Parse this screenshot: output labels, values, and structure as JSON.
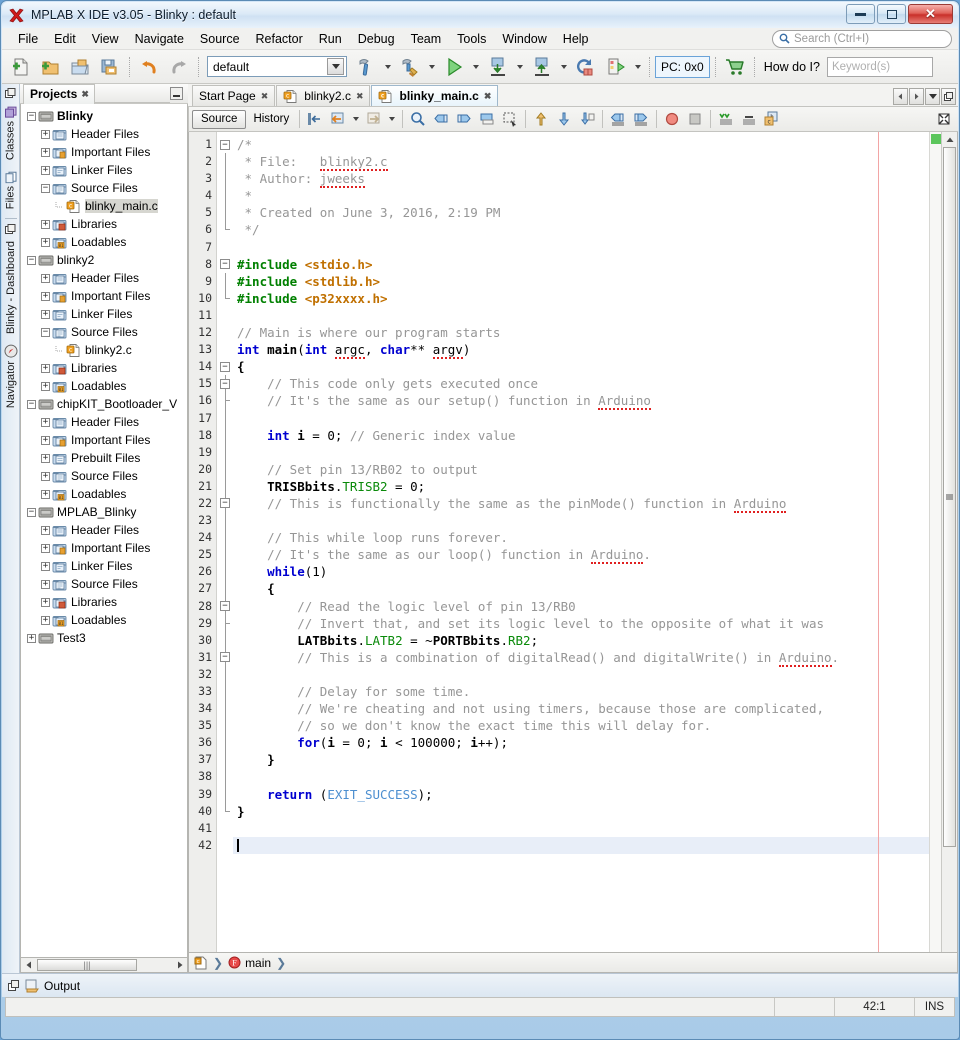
{
  "window": {
    "title": "MPLAB X IDE v3.05 - Blinky : default",
    "app_icon": "mplab-x-icon",
    "minimize": "minimize",
    "maximize": "maximize",
    "close": "close"
  },
  "menubar": {
    "items": [
      "File",
      "Edit",
      "View",
      "Navigate",
      "Source",
      "Refactor",
      "Run",
      "Debug",
      "Team",
      "Tools",
      "Window",
      "Help"
    ],
    "search_placeholder": "Search (Ctrl+I)"
  },
  "toolbar": {
    "buttons": [
      {
        "name": "new-file",
        "icon": "new-file-icon"
      },
      {
        "name": "new-project",
        "icon": "new-project-icon"
      },
      {
        "name": "open-project",
        "icon": "open-project-icon"
      },
      {
        "name": "save-all",
        "icon": "save-all-icon"
      },
      {
        "name": "undo",
        "icon": "undo-icon"
      },
      {
        "name": "redo",
        "icon": "redo-icon"
      }
    ],
    "configuration": "default",
    "build_buttons": [
      {
        "name": "build-project",
        "icon": "hammer-icon"
      },
      {
        "name": "clean-and-build",
        "icon": "hammer-broom-icon"
      },
      {
        "name": "run-project",
        "icon": "run-green-arrow-icon"
      },
      {
        "name": "debug-project",
        "icon": "debug-down-icon"
      },
      {
        "name": "program-device",
        "icon": "program-up-icon"
      },
      {
        "name": "hold-in-reset",
        "icon": "reset-icon"
      },
      {
        "name": "step-over",
        "icon": "step-icon"
      }
    ],
    "pc_indicator": "PC: 0x0",
    "cart_icon": "shopping-cart-icon",
    "how_do_i_label": "How do I?",
    "keyword_placeholder": "Keyword(s)"
  },
  "leftstrip": {
    "items": [
      "Classes",
      "Files",
      "Blinky - Dashboard",
      "Navigator"
    ]
  },
  "projects": {
    "tab_label": "Projects",
    "tree": [
      {
        "indent": 0,
        "toggle": "minus",
        "icon": "project-icon",
        "label": "Blinky",
        "bold": true
      },
      {
        "indent": 1,
        "toggle": "plus",
        "icon": "folder-header",
        "label": "Header Files"
      },
      {
        "indent": 1,
        "toggle": "plus",
        "icon": "folder-important",
        "label": "Important Files"
      },
      {
        "indent": 1,
        "toggle": "plus",
        "icon": "folder-linker",
        "label": "Linker Files"
      },
      {
        "indent": 1,
        "toggle": "minus",
        "icon": "folder-source",
        "label": "Source Files"
      },
      {
        "indent": 2,
        "toggle": "none",
        "icon": "c-file-icon",
        "label": "blinky_main.c",
        "selected": true
      },
      {
        "indent": 1,
        "toggle": "plus",
        "icon": "folder-lib",
        "label": "Libraries"
      },
      {
        "indent": 1,
        "toggle": "plus",
        "icon": "folder-load",
        "label": "Loadables"
      },
      {
        "indent": 0,
        "toggle": "minus",
        "icon": "project-icon",
        "label": "blinky2"
      },
      {
        "indent": 1,
        "toggle": "plus",
        "icon": "folder-header",
        "label": "Header Files"
      },
      {
        "indent": 1,
        "toggle": "plus",
        "icon": "folder-important",
        "label": "Important Files"
      },
      {
        "indent": 1,
        "toggle": "plus",
        "icon": "folder-linker",
        "label": "Linker Files"
      },
      {
        "indent": 1,
        "toggle": "minus",
        "icon": "folder-source",
        "label": "Source Files"
      },
      {
        "indent": 2,
        "toggle": "none",
        "icon": "c-file-icon",
        "label": "blinky2.c"
      },
      {
        "indent": 1,
        "toggle": "plus",
        "icon": "folder-lib",
        "label": "Libraries"
      },
      {
        "indent": 1,
        "toggle": "plus",
        "icon": "folder-load",
        "label": "Loadables"
      },
      {
        "indent": 0,
        "toggle": "minus",
        "icon": "project-icon",
        "label": "chipKIT_Bootloader_V"
      },
      {
        "indent": 1,
        "toggle": "plus",
        "icon": "folder-header",
        "label": "Header Files"
      },
      {
        "indent": 1,
        "toggle": "plus",
        "icon": "folder-important",
        "label": "Important Files"
      },
      {
        "indent": 1,
        "toggle": "plus",
        "icon": "folder-prebuilt",
        "label": "Prebuilt Files"
      },
      {
        "indent": 1,
        "toggle": "plus",
        "icon": "folder-source",
        "label": "Source Files"
      },
      {
        "indent": 1,
        "toggle": "plus",
        "icon": "folder-load",
        "label": "Loadables"
      },
      {
        "indent": 0,
        "toggle": "minus",
        "icon": "project-icon",
        "label": "MPLAB_Blinky"
      },
      {
        "indent": 1,
        "toggle": "plus",
        "icon": "folder-header",
        "label": "Header Files"
      },
      {
        "indent": 1,
        "toggle": "plus",
        "icon": "folder-important",
        "label": "Important Files"
      },
      {
        "indent": 1,
        "toggle": "plus",
        "icon": "folder-linker",
        "label": "Linker Files"
      },
      {
        "indent": 1,
        "toggle": "plus",
        "icon": "folder-source",
        "label": "Source Files"
      },
      {
        "indent": 1,
        "toggle": "plus",
        "icon": "folder-lib",
        "label": "Libraries"
      },
      {
        "indent": 1,
        "toggle": "plus",
        "icon": "folder-load",
        "label": "Loadables"
      },
      {
        "indent": 0,
        "toggle": "plus",
        "icon": "project-icon",
        "label": "Test3"
      }
    ]
  },
  "editor": {
    "tabs": [
      {
        "label": "Start Page",
        "icon": null,
        "active": false
      },
      {
        "label": "blinky2.c",
        "icon": "c-file-icon",
        "active": false
      },
      {
        "label": "blinky_main.c",
        "icon": "c-file-icon",
        "active": true
      }
    ],
    "view_buttons": {
      "source": "Source",
      "history": "History"
    },
    "toolbar_icons": [
      "last-edit-icon",
      "back-icon",
      "forward-icon",
      "find-selection-icon",
      "previous-bookmark-icon",
      "next-bookmark-icon",
      "toggle-bookmark-icon",
      "rectangular-selection-icon",
      "previous-error-icon",
      "next-error-icon",
      "inspect-icon",
      "shift-left-icon",
      "shift-right-icon",
      "toggle-breakpoint-icon",
      "stop-icon",
      "comment-icon",
      "uncomment-icon",
      "header-source-icon"
    ],
    "maximize_icon": "maximize-window-icon",
    "breadcrumb": {
      "file_icon": "c-file-icon",
      "member_icon": "function-icon",
      "member": "main"
    },
    "status": {
      "position": "42:1",
      "mode": "INS"
    },
    "cursor_line": 42,
    "total_lines": 42,
    "fold_lines": [
      1,
      8,
      14,
      15,
      22,
      28,
      31
    ],
    "code": [
      {
        "n": 1,
        "tokens": [
          {
            "t": "/*",
            "c": "cmt"
          }
        ]
      },
      {
        "n": 2,
        "tokens": [
          {
            "t": " * File:   ",
            "c": "cmt"
          },
          {
            "t": "blinky2.c",
            "c": "cmt sq"
          }
        ]
      },
      {
        "n": 3,
        "tokens": [
          {
            "t": " * Author: ",
            "c": "cmt"
          },
          {
            "t": "jweeks",
            "c": "cmt sq"
          }
        ]
      },
      {
        "n": 4,
        "tokens": [
          {
            "t": " *",
            "c": "cmt"
          }
        ]
      },
      {
        "n": 5,
        "tokens": [
          {
            "t": " * Created on June 3, 2016, 2:19 PM",
            "c": "cmt"
          }
        ]
      },
      {
        "n": 6,
        "tokens": [
          {
            "t": " */",
            "c": "cmt"
          }
        ]
      },
      {
        "n": 7,
        "tokens": []
      },
      {
        "n": 8,
        "tokens": [
          {
            "t": "#include ",
            "c": "pre"
          },
          {
            "t": "<stdio.h>",
            "c": "hdr"
          }
        ]
      },
      {
        "n": 9,
        "tokens": [
          {
            "t": "#include ",
            "c": "pre"
          },
          {
            "t": "<stdlib.h>",
            "c": "hdr"
          }
        ]
      },
      {
        "n": 10,
        "tokens": [
          {
            "t": "#include ",
            "c": "pre"
          },
          {
            "t": "<p32xxxx.h>",
            "c": "hdr"
          }
        ]
      },
      {
        "n": 11,
        "tokens": []
      },
      {
        "n": 12,
        "tokens": [
          {
            "t": "// Main is where our program starts",
            "c": "cmt"
          }
        ]
      },
      {
        "n": 13,
        "tokens": [
          {
            "t": "int ",
            "c": "kwd"
          },
          {
            "t": "main",
            "c": "idb"
          },
          {
            "t": "(",
            "c": ""
          },
          {
            "t": "int ",
            "c": "kwd"
          },
          {
            "t": "argc",
            "c": "sq"
          },
          {
            "t": ", ",
            "c": ""
          },
          {
            "t": "char",
            "c": "kwd"
          },
          {
            "t": "** ",
            "c": ""
          },
          {
            "t": "argv",
            "c": "sq"
          },
          {
            "t": ")",
            "c": ""
          }
        ]
      },
      {
        "n": 14,
        "tokens": [
          {
            "t": "{",
            "c": "idb"
          }
        ]
      },
      {
        "n": 15,
        "tokens": [
          {
            "t": "    // This code only gets executed once",
            "c": "cmt"
          }
        ]
      },
      {
        "n": 16,
        "tokens": [
          {
            "t": "    // It's the same as our setup() function in ",
            "c": "cmt"
          },
          {
            "t": "Arduino",
            "c": "cmt sq"
          }
        ]
      },
      {
        "n": 17,
        "tokens": []
      },
      {
        "n": 18,
        "tokens": [
          {
            "t": "    ",
            "c": ""
          },
          {
            "t": "int ",
            "c": "kwd"
          },
          {
            "t": "i",
            "c": "idb"
          },
          {
            "t": " = 0; ",
            "c": ""
          },
          {
            "t": "// Generic index value",
            "c": "cmt"
          }
        ]
      },
      {
        "n": 19,
        "tokens": []
      },
      {
        "n": 20,
        "tokens": [
          {
            "t": "    // Set pin 13/RB02 to output",
            "c": "cmt"
          }
        ]
      },
      {
        "n": 21,
        "tokens": [
          {
            "t": "    ",
            "c": ""
          },
          {
            "t": "TRISBbits",
            "c": "idb"
          },
          {
            "t": ".",
            "c": ""
          },
          {
            "t": "TRISB2",
            "c": "fld"
          },
          {
            "t": " = 0;",
            "c": ""
          }
        ]
      },
      {
        "n": 22,
        "tokens": [
          {
            "t": "    // This is functionally the same as the pinMode() function in ",
            "c": "cmt"
          },
          {
            "t": "Arduino",
            "c": "cmt sq"
          }
        ]
      },
      {
        "n": 23,
        "tokens": []
      },
      {
        "n": 24,
        "tokens": [
          {
            "t": "    // This while loop runs forever.",
            "c": "cmt"
          }
        ]
      },
      {
        "n": 25,
        "tokens": [
          {
            "t": "    // It's the same as our loop() function in ",
            "c": "cmt"
          },
          {
            "t": "Arduino",
            "c": "cmt sq"
          },
          {
            "t": ".",
            "c": "cmt"
          }
        ]
      },
      {
        "n": 26,
        "tokens": [
          {
            "t": "    ",
            "c": ""
          },
          {
            "t": "while",
            "c": "kwd"
          },
          {
            "t": "(1)",
            "c": ""
          }
        ]
      },
      {
        "n": 27,
        "tokens": [
          {
            "t": "    {",
            "c": "idb"
          }
        ]
      },
      {
        "n": 28,
        "tokens": [
          {
            "t": "        // Read the logic level of pin 13/RB0",
            "c": "cmt"
          }
        ]
      },
      {
        "n": 29,
        "tokens": [
          {
            "t": "        // Invert that, and set its logic level to the opposite of what it was",
            "c": "cmt"
          }
        ]
      },
      {
        "n": 30,
        "tokens": [
          {
            "t": "        ",
            "c": ""
          },
          {
            "t": "LATBbits",
            "c": "idb"
          },
          {
            "t": ".",
            "c": ""
          },
          {
            "t": "LATB2",
            "c": "fld"
          },
          {
            "t": " = ~",
            "c": ""
          },
          {
            "t": "PORTBbits",
            "c": "idb"
          },
          {
            "t": ".",
            "c": ""
          },
          {
            "t": "RB2",
            "c": "fld"
          },
          {
            "t": ";",
            "c": ""
          }
        ]
      },
      {
        "n": 31,
        "tokens": [
          {
            "t": "        // This is a combination of digitalRead() and digitalWrite() in ",
            "c": "cmt"
          },
          {
            "t": "Arduino",
            "c": "cmt sq"
          },
          {
            "t": ".",
            "c": "cmt"
          }
        ]
      },
      {
        "n": 32,
        "tokens": []
      },
      {
        "n": 33,
        "tokens": [
          {
            "t": "        // Delay for some time.",
            "c": "cmt"
          }
        ]
      },
      {
        "n": 34,
        "tokens": [
          {
            "t": "        // We're cheating and not using timers, because those are complicated,",
            "c": "cmt"
          }
        ]
      },
      {
        "n": 35,
        "tokens": [
          {
            "t": "        // so we don't know the exact time this will delay for.",
            "c": "cmt"
          }
        ]
      },
      {
        "n": 36,
        "tokens": [
          {
            "t": "        ",
            "c": ""
          },
          {
            "t": "for",
            "c": "kwd"
          },
          {
            "t": "(",
            "c": ""
          },
          {
            "t": "i",
            "c": "idb"
          },
          {
            "t": " = 0; ",
            "c": ""
          },
          {
            "t": "i",
            "c": "idb"
          },
          {
            "t": " < 100000; ",
            "c": ""
          },
          {
            "t": "i",
            "c": "idb"
          },
          {
            "t": "++);",
            "c": ""
          }
        ]
      },
      {
        "n": 37,
        "tokens": [
          {
            "t": "    }",
            "c": "idb"
          }
        ]
      },
      {
        "n": 38,
        "tokens": []
      },
      {
        "n": 39,
        "tokens": [
          {
            "t": "    ",
            "c": ""
          },
          {
            "t": "return ",
            "c": "kwd"
          },
          {
            "t": "(",
            "c": ""
          },
          {
            "t": "EXIT_SUCCESS",
            "c": "mac"
          },
          {
            "t": ");",
            "c": ""
          }
        ]
      },
      {
        "n": 40,
        "tokens": [
          {
            "t": "}",
            "c": "idb"
          }
        ]
      },
      {
        "n": 41,
        "tokens": []
      },
      {
        "n": 42,
        "tokens": [],
        "cursor": true
      }
    ]
  },
  "bottom": {
    "output_tab": "Output",
    "float_icon": "float-window-icon",
    "output_icon": "output-icon"
  },
  "colors": {
    "keyword": "#0000d0",
    "comment": "#969696",
    "preprocessor": "#008000",
    "header": "#c07000",
    "field": "#0a8a0a",
    "macro": "#4d8fd0",
    "cursor_line": "#e8eef8",
    "accent": "#6aa3d8"
  }
}
